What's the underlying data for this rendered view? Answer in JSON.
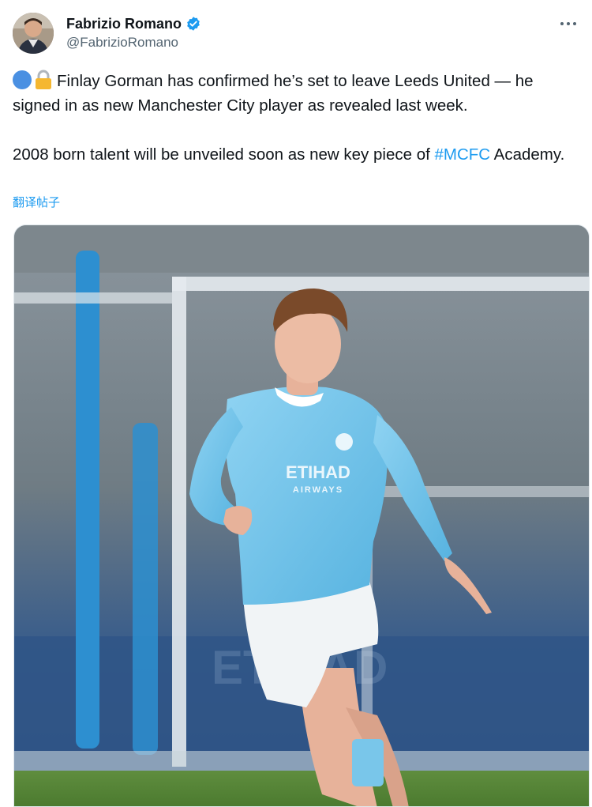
{
  "author": {
    "display_name": "Fabrizio Romano",
    "handle": "@FabrizioRomano",
    "verified": true,
    "avatar_icon": "profile-photo"
  },
  "tweet": {
    "line1": "Finlay Gorman has confirmed he’s set to leave Leeds United — he signed in as new Manchester City player as revealed last week.",
    "line2_before": "2008 born talent will be unveiled soon as new key piece of ",
    "hashtag": "#MCFC",
    "line2_after": " Academy.",
    "translate_label": "翻译帖子",
    "emoji_icons": [
      "blue-circle-icon",
      "lock-icon"
    ]
  },
  "media": {
    "shirt_sponsor": "ETIHAD",
    "shirt_sponsor_sub": "AIRWAYS"
  },
  "colors": {
    "link": "#1d9bf0",
    "text": "#0f1419",
    "secondary": "#536471",
    "kit_blue": "#6cc3ea"
  }
}
